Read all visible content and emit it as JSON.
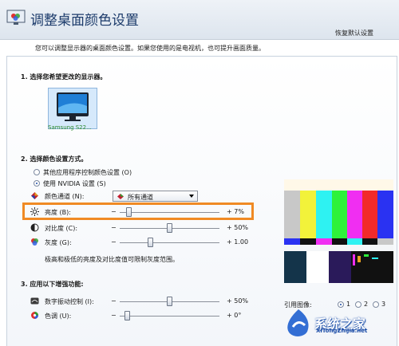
{
  "header": {
    "title": "调整桌面颜色设置",
    "restore_defaults": "恢复默认设置"
  },
  "intro": "您可以调整显示器的桌面颜色设置。如果您使用的是电视机，也可提升画面质量。",
  "section1": {
    "title": "1. 选择您希望更改的显示器。",
    "monitor_label": "Samsung S22..."
  },
  "section2": {
    "title": "2. 选择颜色设置方式。",
    "radio_other": "其他应用程序控制颜色设置 (O)",
    "radio_nvidia": "使用 NVIDIA 设置 (S)",
    "channel_label": "颜色通道 (N):",
    "channel_value": "所有通道",
    "brightness_label": "亮度 (B):",
    "brightness_value": "+ 7%",
    "brightness_level": 0.07,
    "contrast_label": "对比度 (C):",
    "contrast_value": "+ 50%",
    "contrast_level": 0.5,
    "gamma_label": "灰度 (G):",
    "gamma_value": "+ 1.00",
    "gamma_level": 0.3,
    "note": "极高和极低的亮度及对比度值可限制灰度范围。",
    "minus": "−"
  },
  "section3": {
    "title": "3. 应用以下增强功能:",
    "vibrance_label": "数字振动控制 (I):",
    "vibrance_value": "+ 50%",
    "vibrance_level": 0.5,
    "hue_label": "色调 (U):",
    "hue_value": "+ 0°",
    "hue_level": 0.05,
    "ref_image_label": "引用图像:",
    "ref_opts": [
      "1",
      "2",
      "3"
    ]
  },
  "watermark": {
    "brand": "系统之家",
    "url": "XiTongZhiJia.net"
  },
  "colors": {
    "title": "#1c3b6b",
    "highlight": "#f08a24"
  },
  "icons": {
    "app": "monitor-color-icon",
    "channel": "color-channel-icon",
    "brightness": "sun-icon",
    "contrast": "contrast-icon",
    "gamma": "rgb-circles-icon",
    "vibrance": "vibrance-icon",
    "hue": "hue-icon"
  }
}
